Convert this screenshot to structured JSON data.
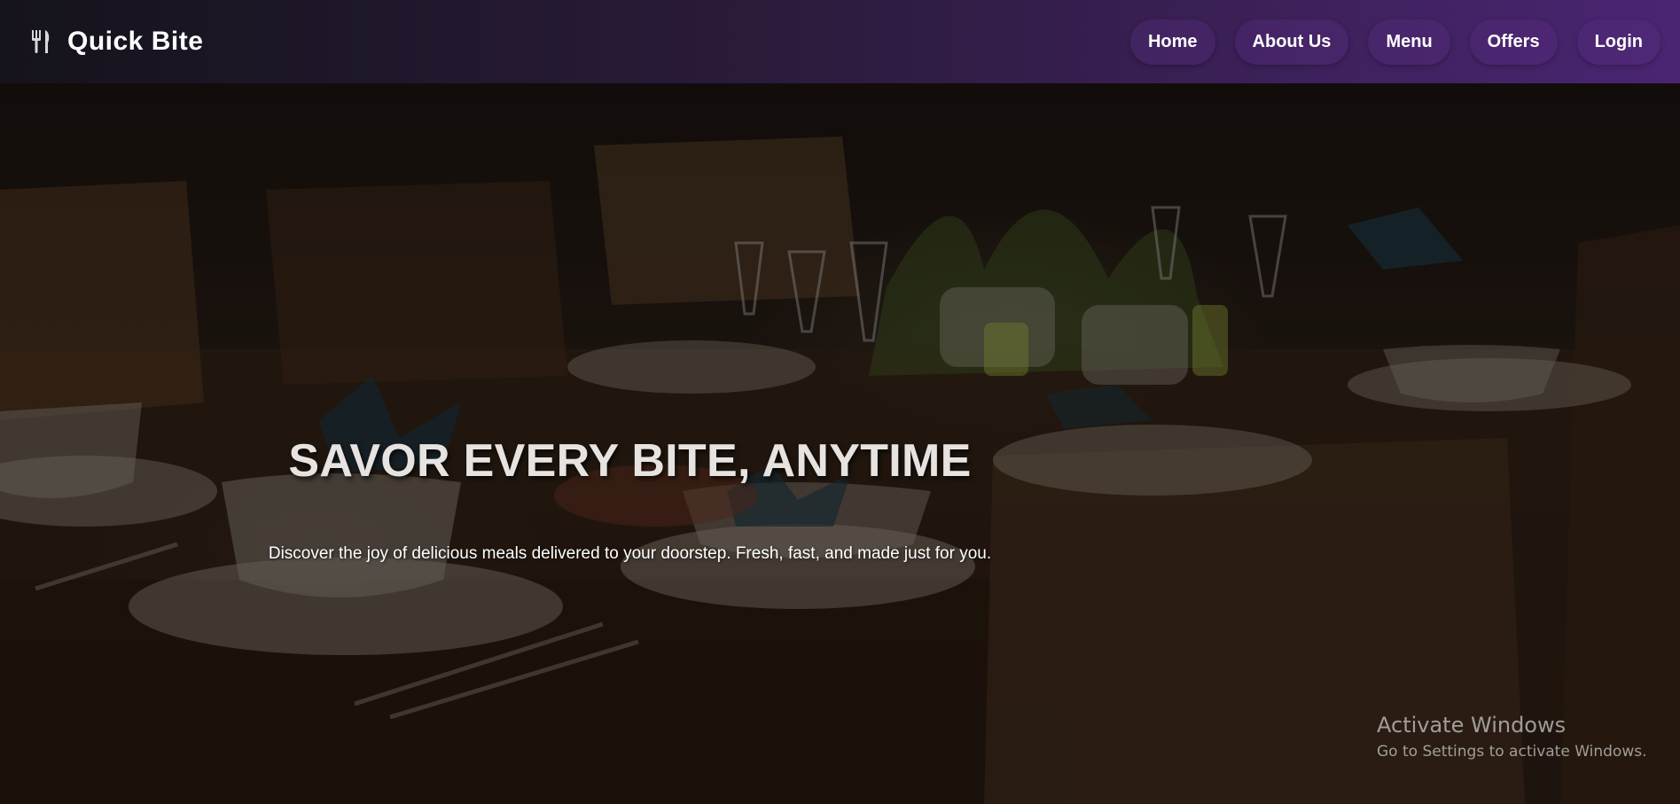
{
  "brand": {
    "name": "Quick Bite",
    "icon": "utensils-icon"
  },
  "nav": {
    "items": [
      {
        "label": "Home"
      },
      {
        "label": "About Us"
      },
      {
        "label": "Menu"
      },
      {
        "label": "Offers"
      },
      {
        "label": "Login"
      }
    ]
  },
  "hero": {
    "title": "SAVOR EVERY BITE, ANYTIME",
    "subtitle": "Discover the joy of delicious meals delivered to your doorstep. Fresh, fast, and made just for you."
  },
  "watermark": {
    "title": "Activate Windows",
    "subtitle": "Go to Settings to activate Windows."
  },
  "colors": {
    "nav_gradient_start": "#15131b",
    "nav_gradient_end": "#4a2572",
    "text": "#ffffff"
  }
}
